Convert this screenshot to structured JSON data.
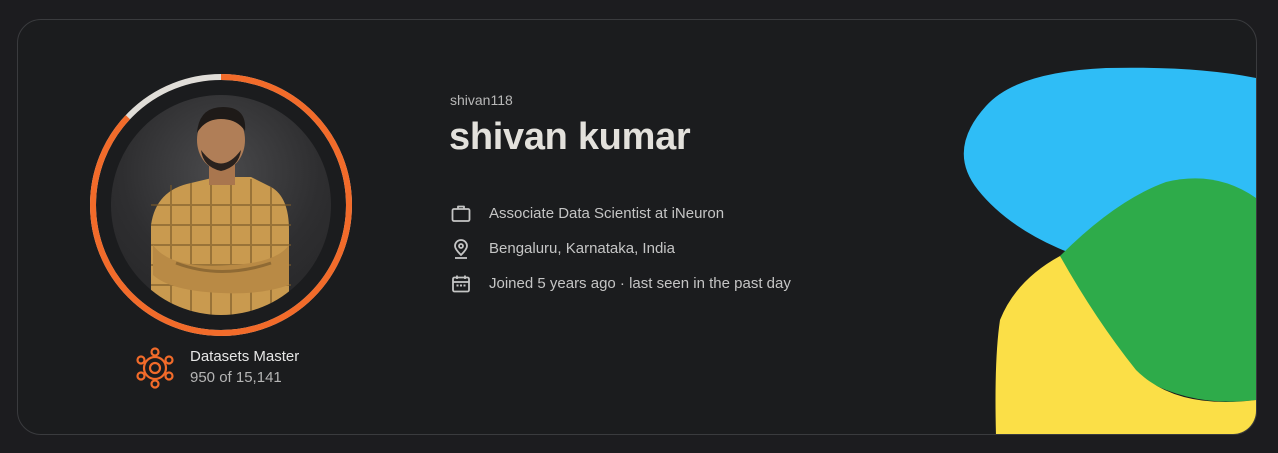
{
  "profile": {
    "username": "shivan118",
    "display_name": "shivan kumar",
    "occupation": "Associate Data Scientist at iNeuron",
    "location": "Bengaluru, Karnataka, India",
    "joined": "Joined 5 years ago · last seen in the past day"
  },
  "tier": {
    "title": "Datasets Master",
    "progress": "950 of 15,141",
    "ring_fill_fraction": 0.87
  },
  "icons": {
    "occupation": "briefcase-icon",
    "location": "location-pin-icon",
    "joined": "calendar-icon",
    "tier": "datasets-master-icon"
  },
  "colors": {
    "accent_orange": "#f26b2a",
    "blob_blue": "#2fbdf6",
    "blob_green": "#2eab4a",
    "blob_yellow": "#fbdf47"
  }
}
